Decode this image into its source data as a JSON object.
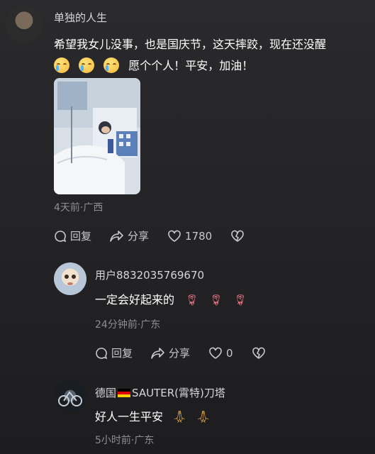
{
  "comments": [
    {
      "username": "单独的人生",
      "text_line1": "希望我女儿没事，也是国庆节，这天摔跤，现在还没醒",
      "text_line2": "愿个个人！平安，加油！",
      "meta": "4天前·广西",
      "actions": {
        "reply": "回复",
        "share": "分享",
        "likes": "1780"
      }
    },
    {
      "username": "用户8832035769670",
      "text": "一定会好起来的",
      "meta": "24分钟前·广东",
      "actions": {
        "reply": "回复",
        "share": "分享",
        "likes": "0"
      }
    },
    {
      "username_prefix": "德国",
      "username_suffix": "SAUTER(霄特)刀塔",
      "text": "好人一生平安",
      "meta": "5小时前·广东"
    }
  ],
  "icons": [
    "cry-emoji",
    "reply-icon",
    "share-icon",
    "heart-icon",
    "broken-heart-icon",
    "rose-emoji",
    "pray-emoji",
    "germany-flag"
  ]
}
